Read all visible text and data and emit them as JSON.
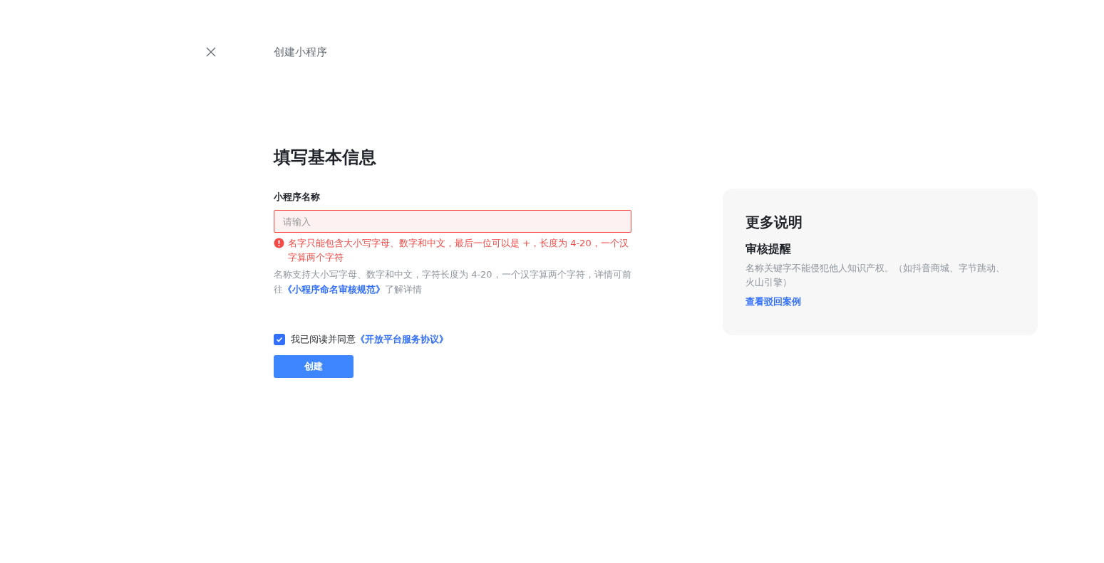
{
  "header": {
    "title": "创建小程序"
  },
  "form": {
    "heading": "填写基本信息",
    "field_label": "小程序名称",
    "input": {
      "placeholder": "请输入",
      "error": true
    },
    "error_message": "名字只能包含大小写字母、数字和中文，最后一位可以是 +，长度为 4-20，一个汉字算两个字符",
    "hint_before": "名称支持大小写字母、数字和中文，字符长度为 4-20，一个汉字算两个字符，详情可前往",
    "hint_link": "《小程序命名审核规范》",
    "hint_after": "了解详情",
    "agreement": {
      "checked": true,
      "text": "我已阅读并同意",
      "link": "《开放平台服务协议》"
    },
    "submit": "创建"
  },
  "info_card": {
    "title": "更多说明",
    "subtitle": "审核提醒",
    "body": "名称关键字不能侵犯他人知识产权。（如抖音商城、字节跳动、火山引擎）",
    "link": "查看驳回案例"
  }
}
